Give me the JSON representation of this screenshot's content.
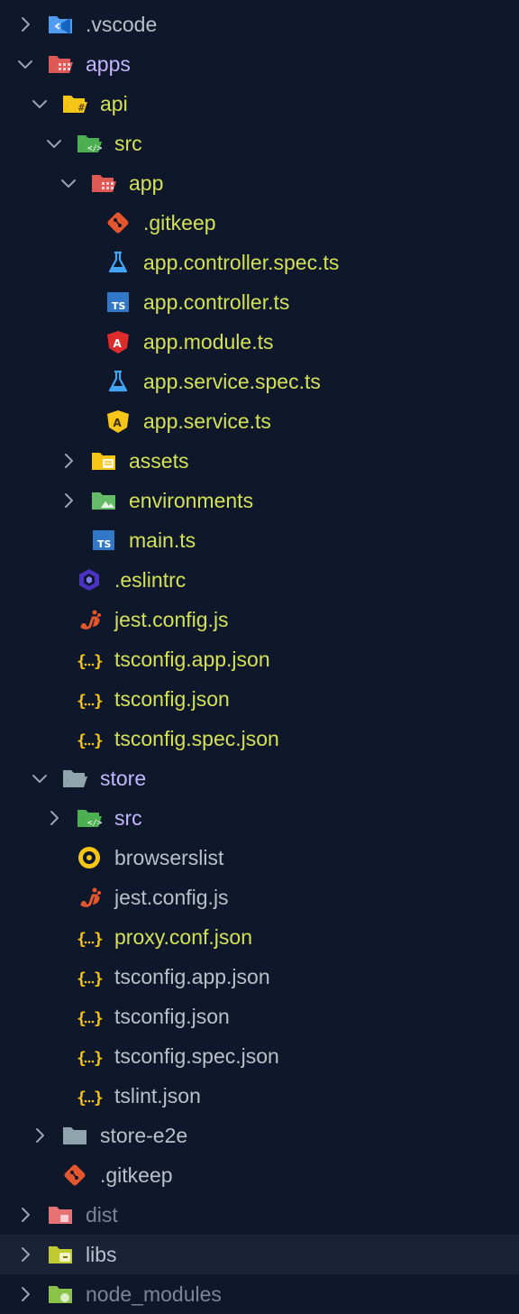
{
  "colors": {
    "background": "#0f172a",
    "text_green": "#d4e157",
    "text_lavender": "#c4b5fd",
    "text_default": "#b8c0cc",
    "text_dim": "#7c8598",
    "chevron": "#9aa3b2",
    "selected_row": "#1a2237"
  },
  "tree": [
    {
      "label": ".vscode",
      "depth": 0,
      "chevron": "right",
      "icon": "vscode-folder-icon",
      "tone": "default"
    },
    {
      "label": "apps",
      "depth": 0,
      "chevron": "down",
      "icon": "apps-folder-icon",
      "tone": "lavender"
    },
    {
      "label": "api",
      "depth": 1,
      "chevron": "down",
      "icon": "api-folder-icon",
      "tone": "green"
    },
    {
      "label": "src",
      "depth": 2,
      "chevron": "down",
      "icon": "src-folder-icon",
      "tone": "green"
    },
    {
      "label": "app",
      "depth": 3,
      "chevron": "down",
      "icon": "app-folder-icon",
      "tone": "green"
    },
    {
      "label": ".gitkeep",
      "depth": 4,
      "chevron": "none",
      "icon": "git-icon",
      "tone": "green"
    },
    {
      "label": "app.controller.spec.ts",
      "depth": 4,
      "chevron": "none",
      "icon": "test-flask-icon",
      "tone": "green"
    },
    {
      "label": "app.controller.ts",
      "depth": 4,
      "chevron": "none",
      "icon": "typescript-icon",
      "tone": "green"
    },
    {
      "label": "app.module.ts",
      "depth": 4,
      "chevron": "none",
      "icon": "angular-red-icon",
      "tone": "green"
    },
    {
      "label": "app.service.spec.ts",
      "depth": 4,
      "chevron": "none",
      "icon": "test-flask-icon",
      "tone": "green"
    },
    {
      "label": "app.service.ts",
      "depth": 4,
      "chevron": "none",
      "icon": "angular-yellow-icon",
      "tone": "green"
    },
    {
      "label": "assets",
      "depth": 3,
      "chevron": "right",
      "icon": "assets-folder-icon",
      "tone": "green"
    },
    {
      "label": "environments",
      "depth": 3,
      "chevron": "right",
      "icon": "environments-folder-icon",
      "tone": "green"
    },
    {
      "label": "main.ts",
      "depth": 3,
      "chevron": "none",
      "icon": "typescript-icon",
      "tone": "green"
    },
    {
      "label": ".eslintrc",
      "depth": 2,
      "chevron": "none",
      "icon": "eslint-icon",
      "tone": "green"
    },
    {
      "label": "jest.config.js",
      "depth": 2,
      "chevron": "none",
      "icon": "jest-icon",
      "tone": "green"
    },
    {
      "label": "tsconfig.app.json",
      "depth": 2,
      "chevron": "none",
      "icon": "json-icon",
      "tone": "green"
    },
    {
      "label": "tsconfig.json",
      "depth": 2,
      "chevron": "none",
      "icon": "json-icon",
      "tone": "green"
    },
    {
      "label": "tsconfig.spec.json",
      "depth": 2,
      "chevron": "none",
      "icon": "json-icon",
      "tone": "green"
    },
    {
      "label": "store",
      "depth": 1,
      "chevron": "down",
      "icon": "folder-open-icon",
      "tone": "lavender"
    },
    {
      "label": "src",
      "depth": 2,
      "chevron": "right",
      "icon": "src-folder-icon",
      "tone": "lavender"
    },
    {
      "label": "browserslist",
      "depth": 2,
      "chevron": "none",
      "icon": "browserslist-icon",
      "tone": "default"
    },
    {
      "label": "jest.config.js",
      "depth": 2,
      "chevron": "none",
      "icon": "jest-icon",
      "tone": "default"
    },
    {
      "label": "proxy.conf.json",
      "depth": 2,
      "chevron": "none",
      "icon": "json-icon",
      "tone": "green"
    },
    {
      "label": "tsconfig.app.json",
      "depth": 2,
      "chevron": "none",
      "icon": "json-icon",
      "tone": "default"
    },
    {
      "label": "tsconfig.json",
      "depth": 2,
      "chevron": "none",
      "icon": "json-icon",
      "tone": "default"
    },
    {
      "label": "tsconfig.spec.json",
      "depth": 2,
      "chevron": "none",
      "icon": "json-icon",
      "tone": "default"
    },
    {
      "label": "tslint.json",
      "depth": 2,
      "chevron": "none",
      "icon": "json-icon",
      "tone": "default"
    },
    {
      "label": "store-e2e",
      "depth": 1,
      "chevron": "right",
      "icon": "folder-closed-icon",
      "tone": "default"
    },
    {
      "label": ".gitkeep",
      "depth": 1,
      "chevron": "none",
      "icon": "git-icon",
      "tone": "default"
    },
    {
      "label": "dist",
      "depth": 0,
      "chevron": "right",
      "icon": "dist-folder-icon",
      "tone": "dim"
    },
    {
      "label": "libs",
      "depth": 0,
      "chevron": "right",
      "icon": "libs-folder-icon",
      "tone": "default",
      "selected": true
    },
    {
      "label": "node_modules",
      "depth": 0,
      "chevron": "right",
      "icon": "node-modules-folder-icon",
      "tone": "dim"
    }
  ]
}
